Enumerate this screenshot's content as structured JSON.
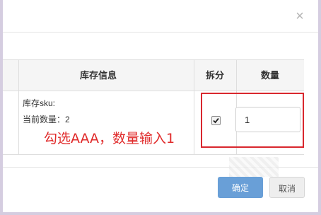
{
  "dialog": {
    "close_glyph": "×"
  },
  "table": {
    "headers": {
      "stock_info": "库存信息",
      "split": "拆分",
      "quantity": "数量"
    },
    "row": {
      "sku_label": "库存sku:",
      "current_qty": "当前数量：2",
      "split_checked": true,
      "quantity_value": "1"
    }
  },
  "annotation": {
    "text": "勾选AAA，数量输入1",
    "color": "#e02a2a"
  },
  "colors": {
    "highlight_border": "#d9272e",
    "primary_button": "#4f8fd1"
  },
  "footer": {
    "confirm_label": "确定",
    "cancel_label": "取消"
  }
}
